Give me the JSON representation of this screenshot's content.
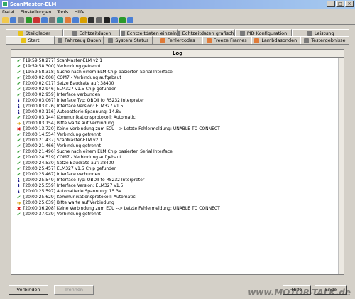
{
  "window": {
    "title": "ScanMaster-ELM"
  },
  "menu": [
    "Datei",
    "Einstellungen",
    "Tools",
    "Hilfe"
  ],
  "toolbar_icons": [
    "open-icon",
    "save-icon",
    "print-icon",
    "connect-icon",
    "disconnect-icon",
    "refresh-icon",
    "settings-icon",
    "graph-icon",
    "export-icon",
    "info-icon",
    "warning-icon",
    "gauge-icon",
    "tools-icon",
    "monitor-icon",
    "car-icon",
    "chart-icon",
    "help-icon"
  ],
  "tabs_row1": [
    {
      "label": "Steilgleder",
      "icon": "ticon-yellow"
    },
    {
      "label": "Echtzeitdaten",
      "icon": "ticon-gray"
    },
    {
      "label": "Echtzeitdaten einzeln",
      "icon": "ticon-gray"
    },
    {
      "label": "Echtzeitdaten grafisch",
      "icon": "ticon-gray"
    },
    {
      "label": "PID Konfiguration",
      "icon": "ticon-gray"
    },
    {
      "label": "Leistung",
      "icon": "ticon-gray"
    }
  ],
  "tabs_row2": [
    {
      "label": "Start",
      "icon": "ticon-yellow",
      "active": true
    },
    {
      "label": "Fahrzeug Daten",
      "icon": "ticon-gray"
    },
    {
      "label": "System Status",
      "icon": "ticon-gray"
    },
    {
      "label": "Fehlercodes",
      "icon": "ticon-orange"
    },
    {
      "label": "Freeze Frames",
      "icon": "ticon-orange"
    },
    {
      "label": "Lambdasonden",
      "icon": "ticon-orange"
    },
    {
      "label": "Testergebnisse",
      "icon": "ticon-gray"
    }
  ],
  "log": {
    "header": "Log",
    "entries": [
      {
        "icon": "check",
        "text": "[19:59:58.277] ScanMaster-ELM v2.1"
      },
      {
        "icon": "check",
        "text": "[19:59:58.300] Verbindung getrennt"
      },
      {
        "icon": "check",
        "text": "[19:59:58.318] Suche nach einem ELM Chip basierten Serial Interface"
      },
      {
        "icon": "check",
        "text": "[20:00:02.008] COM7 - Verbindung aufgebaut"
      },
      {
        "icon": "check",
        "text": "[20:00:02.017] Setze Baudrate auf: 38400"
      },
      {
        "icon": "check",
        "text": "[20:00:02.946] ELM327 v1.5 Chip gefunden"
      },
      {
        "icon": "check",
        "text": "[20:00:02.959] Interface verbunden"
      },
      {
        "icon": "info",
        "text": "[20:00:03.067] Interface Typ: OBDII to RS232 Interpreter"
      },
      {
        "icon": "info",
        "text": "[20:00:03.076] Interface Version: ELM327 v1.5"
      },
      {
        "icon": "info",
        "text": "[20:00:03.116] Autobatterie Spannung: 14.8V"
      },
      {
        "icon": "check",
        "text": "[20:00:03.144] Kommunikationsprotokoll: Automatic"
      },
      {
        "icon": "warn",
        "text": "[20:00:03.154] Bitte warte auf Verbindung"
      },
      {
        "icon": "error",
        "text": "[20:00:13.720] Keine Verbindung zum ECU --> Letzte Fehlermeldung: UNABLE TO CONNECT"
      },
      {
        "icon": "check",
        "text": "[20:00:14.554] Verbindung getrennt"
      },
      {
        "icon": "check",
        "text": "[20:00:21.437] ScanMaster-ELM v2.1"
      },
      {
        "icon": "check",
        "text": "[20:00:21.466] Verbindung getrennt"
      },
      {
        "icon": "check",
        "text": "[20:00:21.496] Suche nach einem ELM Chip basierten Serial Interface"
      },
      {
        "icon": "check",
        "text": "[20:00:24.519] COM7 - Verbindung aufgebaut"
      },
      {
        "icon": "check",
        "text": "[20:00:24.530] Setze Baudrate auf: 38400"
      },
      {
        "icon": "check",
        "text": "[20:00:25.457] ELM327 v1.5 Chip gefunden"
      },
      {
        "icon": "check",
        "text": "[20:00:25.467] Interface verbunden"
      },
      {
        "icon": "info",
        "text": "[20:00:25.549] Interface Typ: OBDII to RS232 Interpreter"
      },
      {
        "icon": "info",
        "text": "[20:00:25.559] Interface Version: ELM327 v1.5"
      },
      {
        "icon": "info",
        "text": "[20:00:25.597] Autobatterie Spannung: 15.3V"
      },
      {
        "icon": "check",
        "text": "[20:00:25.629] Kommunikationsprotokoll: Automatic"
      },
      {
        "icon": "warn",
        "text": "[20:00:25.639] Bitte warte auf Verbindung"
      },
      {
        "icon": "error",
        "text": "[20:00:36.208] Keine Verbindung zum ECU --> Letzte Fehlermeldung: UNABLE TO CONNECT"
      },
      {
        "icon": "check",
        "text": "[20:00:37.039] Verbindung getrennt"
      }
    ]
  },
  "buttons": {
    "connect": "Verbinden",
    "disconnect": "Trennen",
    "help": "Hilfe",
    "exit": "Ende"
  },
  "watermark": "www.MOTOR-TALK.de",
  "colors": {
    "check": "#2b9a2b",
    "info": "#1d1d8a",
    "error": "#dd1111",
    "warn": "#d8a000",
    "titlebar": "#7a96df"
  }
}
